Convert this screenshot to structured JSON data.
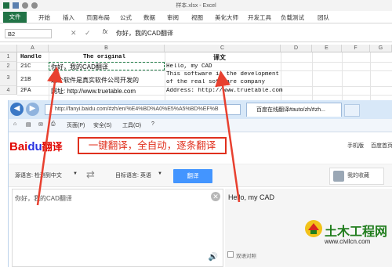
{
  "excel": {
    "window_title": "样本.xlsx - Excel",
    "ribbon_tabs": [
      "文件",
      "开始",
      "插入",
      "页面布局",
      "公式",
      "数据",
      "审阅",
      "视图",
      "美化大师",
      "开发工具",
      "负载测试",
      "团队"
    ],
    "name_box": "B2",
    "fx": "fx",
    "formula_value": "你好，我的CAD翻译",
    "columns": [
      "A",
      "B",
      "C",
      "D",
      "E",
      "F",
      "G"
    ],
    "rows": [
      {
        "n": "1",
        "a": "Handle",
        "b": "The original",
        "c": "译文"
      },
      {
        "n": "2",
        "a": "21C",
        "b": "你好，我的CAD翻译",
        "c": "Hello, my CAD"
      },
      {
        "n": "",
        "a": "",
        "b": "",
        "c": "This software is the development"
      },
      {
        "n": "3",
        "a": "21B",
        "b": "这个软件是真实软件公司开发的",
        "c": "of the real software company"
      },
      {
        "n": "4",
        "a": "2FA",
        "b": "网址: http://www.truetable.com",
        "c": "Address: http://www.truetable.com"
      }
    ]
  },
  "browser": {
    "address": "http://fanyi.baidu.com/#zh/en/%E4%BD%A0%E5%A5%BD%EF%B",
    "tab_title": "百度在线翻译#auto/zh/#zh...",
    "toolbar": [
      "页面(P)",
      "安全(S)",
      "工具(O)"
    ],
    "logo_bai": "Bai",
    "logo_du": "du",
    "logo_fy": "翻译",
    "slogan": "一键翻译，全自动，逐条翻译",
    "top_links": [
      "手机版",
      "百度首页"
    ],
    "source_lang": "源语言: 检测到中文",
    "target_lang": "目标语言: 英语",
    "translate_btn": "翻译",
    "collect": "我的收藏",
    "source_text": "你好，我的CAD翻译",
    "translation": "Hello, my CAD",
    "checkbox_label": "双语对照"
  },
  "watermark": {
    "title": "土木工程网",
    "url": "www.civilcn.com"
  },
  "colors": {
    "excel_green": "#217346",
    "arrow_red": "#e8402f",
    "baidu_blue": "#4395ff",
    "watermark_green": "#207d1d"
  }
}
